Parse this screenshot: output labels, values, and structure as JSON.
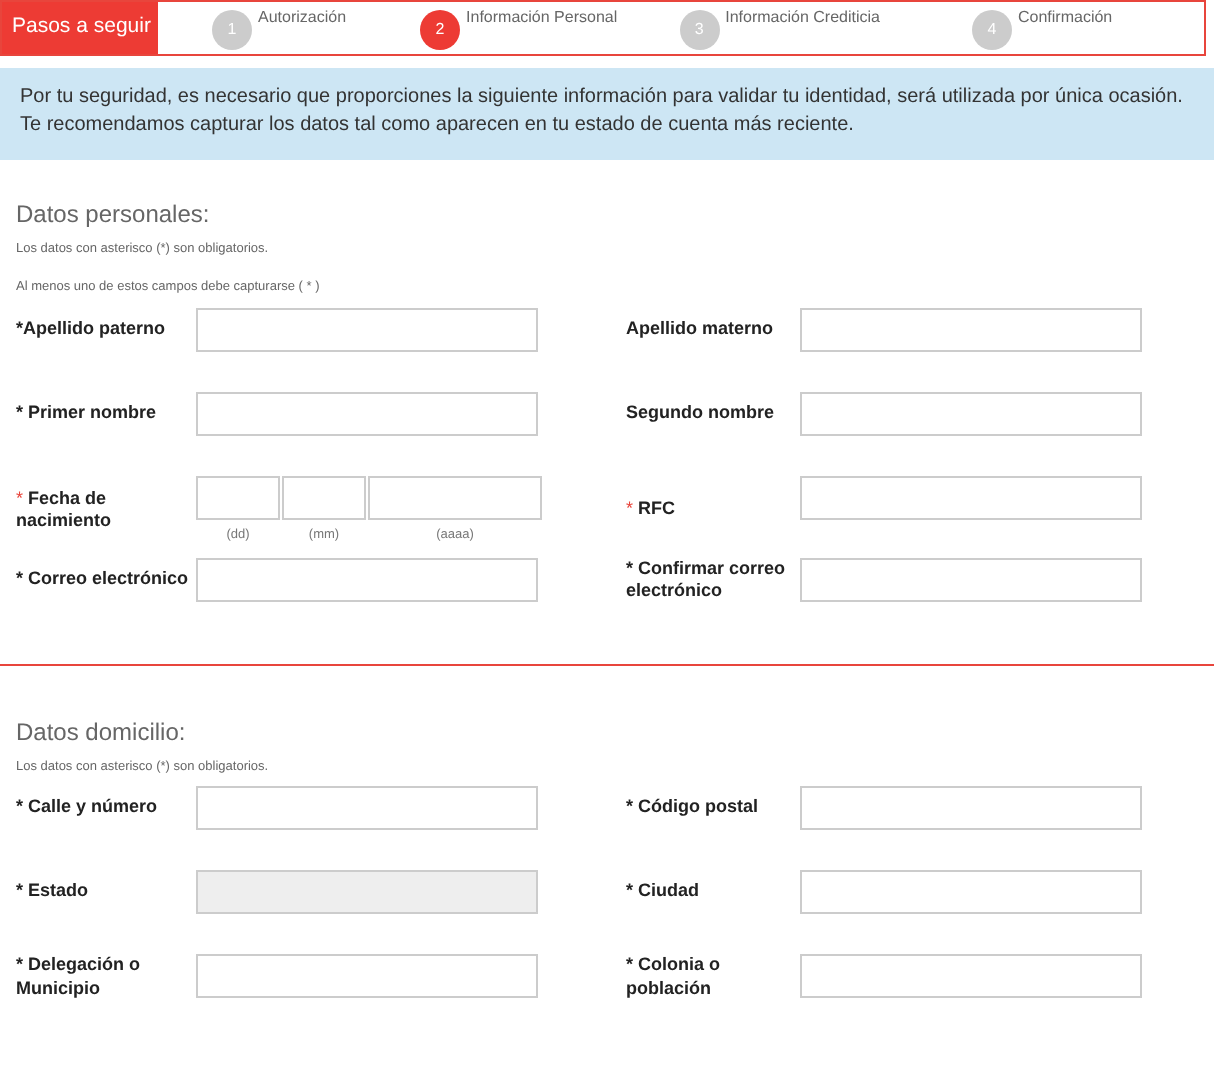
{
  "steps_title": "Pasos a seguir",
  "steps": [
    {
      "number": "1",
      "label": "Autorización",
      "selected": false
    },
    {
      "number": "2",
      "label": "Información Personal",
      "selected": true
    },
    {
      "number": "3",
      "label": "Información Crediticia",
      "selected": false
    },
    {
      "number": "4",
      "label": "Confirmación",
      "selected": false
    }
  ],
  "notice": "Por tu seguridad, es necesario que proporciones la siguiente información para validar tu identidad, será utilizada por única ocasión. Te recomendamos capturar los datos tal como aparecen en tu estado de cuenta más reciente.",
  "sections": [
    {
      "title": "Datos personales:",
      "notes": [
        "Los datos con asterisco (*) son obligatorios.",
        "Al menos uno de estos campos debe capturarse ( * )"
      ],
      "rows": [
        [
          {
            "kind": "text",
            "label": "*Apellido paterno"
          },
          {
            "kind": "text",
            "label": "Apellido materno"
          }
        ],
        [
          {
            "kind": "text",
            "label": "* Primer nombre"
          },
          {
            "kind": "text",
            "label": "Segundo nombre"
          }
        ],
        [
          {
            "kind": "date",
            "marker": "*",
            "label": "Fecha de nacimiento",
            "hints": [
              "(dd)",
              "(mm)",
              "(aaaa)"
            ]
          },
          {
            "kind": "text",
            "marker": "*",
            "label": "RFC"
          }
        ],
        [
          {
            "kind": "text",
            "label": "* Correo electrónico"
          },
          {
            "kind": "text",
            "label": "* Confirmar correo electrónico"
          }
        ]
      ]
    },
    {
      "title": "Datos domicilio:",
      "notes": [
        "Los datos con asterisco (*) son obligatorios."
      ],
      "rows": [
        [
          {
            "kind": "text",
            "label": "* Calle y número"
          },
          {
            "kind": "text",
            "label": "* Código postal"
          }
        ],
        [
          {
            "kind": "text",
            "label": "* Estado",
            "disabled": true
          },
          {
            "kind": "text",
            "label": "* Ciudad"
          }
        ],
        [
          {
            "kind": "text",
            "label": "* Delegación o Municipio"
          },
          {
            "kind": "text",
            "label": "* Colonia o población"
          }
        ]
      ]
    }
  ]
}
